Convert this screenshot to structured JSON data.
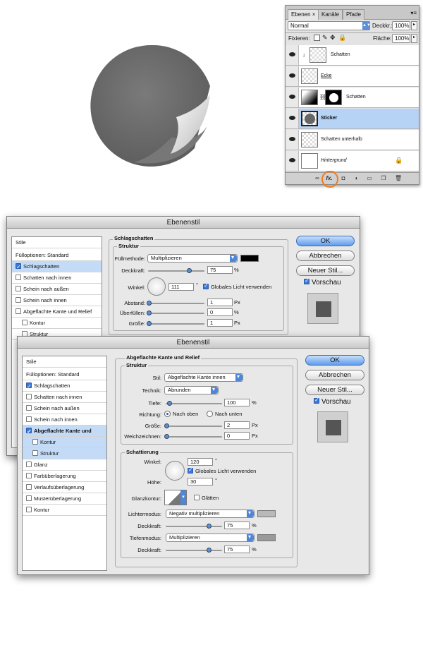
{
  "layers_panel": {
    "tabs": [
      "Ebenen ×",
      "Kanäle",
      "Pfade"
    ],
    "blend_mode": "Normal",
    "opacity_label": "Deckkr.:",
    "opacity_value": "100%",
    "lock_label": "Fixieren:",
    "fill_label": "Fläche:",
    "fill_value": "100%",
    "layers": [
      {
        "name": "Schatten"
      },
      {
        "name": "Ecke"
      },
      {
        "name": "Schatten"
      },
      {
        "name": "Sticker"
      },
      {
        "name": "Schatten unterhalb"
      },
      {
        "name": "Hintergrund"
      }
    ],
    "fx_label": "fx."
  },
  "dialog1": {
    "title": "Ebenenstil",
    "styles_header": "Stile",
    "blend_options": "Fülloptionen: Standard",
    "styles": [
      "Schlagschatten",
      "Schatten nach innen",
      "Schein nach außen",
      "Schein nach innen",
      "Abgeflachte Kante und Relief",
      "Kontur",
      "Struktur"
    ],
    "section_title": "Schlagschatten",
    "group_title": "Struktur",
    "blend_label": "Füllmethode:",
    "blend_value": "Multiplizieren",
    "opacity_label": "Deckkraft:",
    "opacity_value": "75",
    "angle_label": "Winkel:",
    "angle_value": "111",
    "global_light": "Globales Licht verwenden",
    "distance_label": "Abstand:",
    "distance_value": "1",
    "spread_label": "Überfüllen:",
    "spread_value": "0",
    "size_label": "Größe:",
    "size_value": "1",
    "unit_px": "Px",
    "unit_pct": "%",
    "unit_deg": "°",
    "ok": "OK",
    "cancel": "Abbrechen",
    "new_style": "Neuer Stil...",
    "preview": "Vorschau"
  },
  "dialog2": {
    "title": "Ebenenstil",
    "styles_header": "Stile",
    "blend_options": "Fülloptionen: Standard",
    "styles": [
      "Schlagschatten",
      "Schatten nach innen",
      "Schein nach außen",
      "Schein nach innen",
      "Abgeflachte Kante und Relief",
      "Kontur",
      "Struktur",
      "Glanz",
      "Farbüberlagerung",
      "Verlaufsüberlagerung",
      "Musterüberlagerung",
      "Kontur"
    ],
    "section_title": "Abgeflachte Kante und Relief",
    "group1_title": "Struktur",
    "style_label": "Stil:",
    "style_value": "Abgeflachte Kante innen",
    "technique_label": "Technik:",
    "technique_value": "Abrunden",
    "depth_label": "Tiefe:",
    "depth_value": "100",
    "direction_label": "Richtung:",
    "dir_up": "Nach oben",
    "dir_down": "Nach unten",
    "size_label": "Größe:",
    "size_value": "2",
    "soften_label": "Weichzeichnen:",
    "soften_value": "0",
    "group2_title": "Schattierung",
    "angle_label": "Winkel:",
    "angle_value": "120",
    "global_light": "Globales Licht verwenden",
    "altitude_label": "Höhe:",
    "altitude_value": "30",
    "gloss_label": "Glanzkontur:",
    "antialias": "Glätten",
    "highlight_label": "Lichtermodus:",
    "highlight_value": "Negativ multiplizieren",
    "hl_opacity_label": "Deckkraft:",
    "hl_opacity_value": "75",
    "shadow_label": "Tiefenmodus:",
    "shadow_value": "Multiplizieren",
    "sh_opacity_label": "Deckkraft:",
    "sh_opacity_value": "75",
    "unit_px": "Px",
    "unit_pct": "%",
    "unit_deg": "°",
    "ok": "OK",
    "cancel": "Abbrechen",
    "new_style": "Neuer Stil...",
    "preview": "Vorschau"
  }
}
